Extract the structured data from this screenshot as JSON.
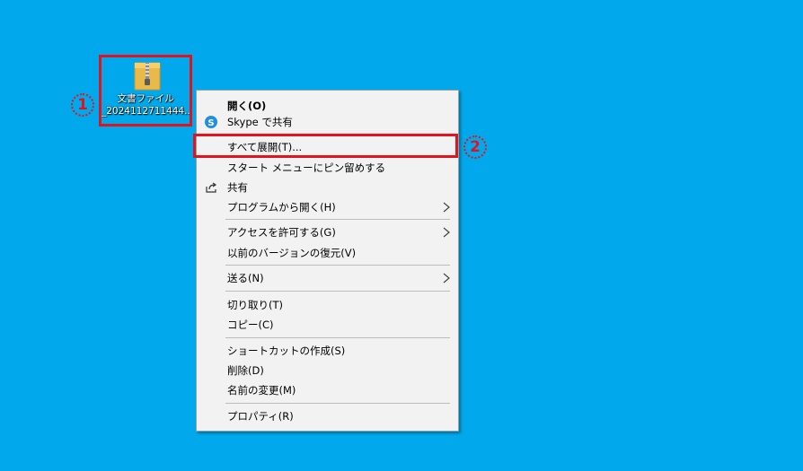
{
  "desktop": {
    "background_color": "#01a9ec",
    "file_icon": {
      "name_line1": "文書ファイル",
      "name_line2": "_2024112711444..."
    }
  },
  "annotations": {
    "callout_1": "1",
    "callout_2": "2",
    "highlight_color": "#e0141e"
  },
  "context_menu": {
    "open": "開く(O)",
    "skype_share": "Skype で共有",
    "extract_all": "すべて展開(T)...",
    "pin_to_start": "スタート メニューにピン留めする",
    "share": "共有",
    "open_with": "プログラムから開く(H)",
    "give_access": "アクセスを許可する(G)",
    "restore_versions": "以前のバージョンの復元(V)",
    "send_to": "送る(N)",
    "cut": "切り取り(T)",
    "copy": "コピー(C)",
    "create_shortcut": "ショートカットの作成(S)",
    "delete": "削除(D)",
    "rename": "名前の変更(M)",
    "properties": "プロパティ(R)"
  }
}
